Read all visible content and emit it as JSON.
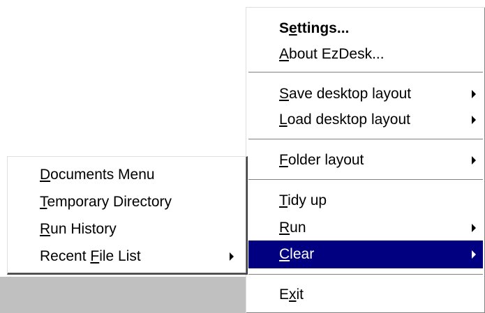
{
  "main_menu": {
    "items": [
      {
        "pre": "S",
        "key": "e",
        "post": "ttings...",
        "bold": true,
        "submenu": false
      },
      {
        "pre": "",
        "key": "A",
        "post": "bout EzDesk...",
        "submenu": false
      },
      {
        "pre": "",
        "key": "S",
        "post": "ave desktop layout",
        "submenu": true
      },
      {
        "pre": "",
        "key": "L",
        "post": "oad desktop layout",
        "submenu": true
      },
      {
        "pre": "",
        "key": "F",
        "post": "older layout",
        "submenu": true
      },
      {
        "pre": "",
        "key": "T",
        "post": "idy up",
        "submenu": false
      },
      {
        "pre": "",
        "key": "R",
        "post": "un",
        "submenu": true
      },
      {
        "pre": "",
        "key": "C",
        "post": "lear",
        "submenu": true,
        "highlighted": true
      },
      {
        "pre": "E",
        "key": "x",
        "post": "it",
        "submenu": false
      }
    ]
  },
  "clear_submenu": {
    "items": [
      {
        "pre": "",
        "key": "D",
        "post": "ocuments Menu",
        "submenu": false
      },
      {
        "pre": "",
        "key": "T",
        "post": "emporary Directory",
        "submenu": false
      },
      {
        "pre": "",
        "key": "R",
        "post": "un History",
        "submenu": false
      },
      {
        "pre": "Recent ",
        "key": "F",
        "post": "ile List",
        "submenu": true
      }
    ]
  },
  "colors": {
    "highlight_bg": "#000080",
    "highlight_text": "#ffffff",
    "menu_bg": "#ffffff",
    "desktop_gray": "#c0c0c0"
  }
}
